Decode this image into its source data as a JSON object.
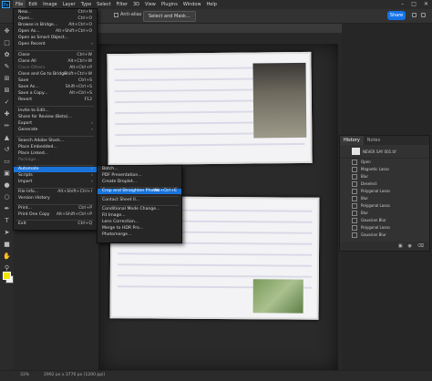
{
  "menubar": {
    "logo": "Ps",
    "items": [
      "File",
      "Edit",
      "Image",
      "Layer",
      "Type",
      "Select",
      "Filter",
      "3D",
      "View",
      "Plugins",
      "Window",
      "Help"
    ]
  },
  "options_bar": {
    "anti_alias_label": "Anti-alias",
    "select_mask_label": "Select and Mask...",
    "share_label": "Share"
  },
  "file_menu": {
    "items": [
      {
        "label": "New...",
        "shortcut": "Ctrl+N"
      },
      {
        "label": "Open...",
        "shortcut": "Ctrl+O"
      },
      {
        "label": "Browse in Bridge...",
        "shortcut": "Alt+Ctrl+O"
      },
      {
        "label": "Open As...",
        "shortcut": "Alt+Shift+Ctrl+O"
      },
      {
        "label": "Open as Smart Object..."
      },
      {
        "label": "Open Recent",
        "arrow": "›"
      },
      {
        "label": "Close",
        "shortcut": "Ctrl+W"
      },
      {
        "label": "Close All",
        "shortcut": "Alt+Ctrl+W"
      },
      {
        "label": "Close Others",
        "shortcut": "Alt+Ctrl+P",
        "disabled": true
      },
      {
        "label": "Close and Go to Bridge...",
        "shortcut": "Shift+Ctrl+W"
      },
      {
        "label": "Save",
        "shortcut": "Ctrl+S"
      },
      {
        "label": "Save As...",
        "shortcut": "Shift+Ctrl+S"
      },
      {
        "label": "Save a Copy...",
        "shortcut": "Alt+Ctrl+S"
      },
      {
        "label": "Revert",
        "shortcut": "F12"
      },
      {
        "label": "Invite to Edit..."
      },
      {
        "label": "Share for Review (Beta)..."
      },
      {
        "label": "Export",
        "arrow": "›"
      },
      {
        "label": "Generate",
        "arrow": "›"
      },
      {
        "label": "Search Adobe Stock..."
      },
      {
        "label": "Place Embedded..."
      },
      {
        "label": "Place Linked..."
      },
      {
        "label": "Package...",
        "disabled": true
      },
      {
        "label": "Automate",
        "arrow": "›",
        "highlight": true
      },
      {
        "label": "Scripts",
        "arrow": "›"
      },
      {
        "label": "Import",
        "arrow": "›"
      },
      {
        "label": "File Info...",
        "shortcut": "Alt+Shift+Ctrl+I"
      },
      {
        "label": "Version History"
      },
      {
        "label": "Print...",
        "shortcut": "Ctrl+P"
      },
      {
        "label": "Print One Copy",
        "shortcut": "Alt+Shift+Ctrl+P"
      },
      {
        "label": "Exit",
        "shortcut": "Ctrl+Q"
      }
    ]
  },
  "automate_submenu": {
    "items": [
      {
        "label": "Batch..."
      },
      {
        "label": "PDF Presentation..."
      },
      {
        "label": "Create Droplet..."
      },
      {
        "label": "Crop and Straighten Photos",
        "shortcut": "Alt+Ctrl+E",
        "highlight": true
      },
      {
        "label": "Contact Sheet II..."
      },
      {
        "label": "Conditional Mode Change..."
      },
      {
        "label": "Fit Image..."
      },
      {
        "label": "Lens Correction..."
      },
      {
        "label": "Merge to HDR Pro..."
      },
      {
        "label": "Photomerge..."
      }
    ]
  },
  "history_panel": {
    "tabs": [
      "History",
      "Notes"
    ],
    "snapshot_name": "NEVER SAY 001.tif",
    "steps": [
      "Open",
      "Magnetic Lasso",
      "Blur",
      "Deselect",
      "Polygonal Lasso",
      "Blur",
      "Polygonal Lasso",
      "Blur",
      "Gaussian Blur",
      "Polygonal Lasso",
      "Gaussian Blur"
    ]
  },
  "status_bar": {
    "zoom": "33%",
    "doc_info": "2992 px x 3776 px (1200 ppi)"
  },
  "colors": {
    "menu_highlight": "#1a73d9",
    "share_button": "#1473e6",
    "foreground_swatch": "#f2e600"
  }
}
